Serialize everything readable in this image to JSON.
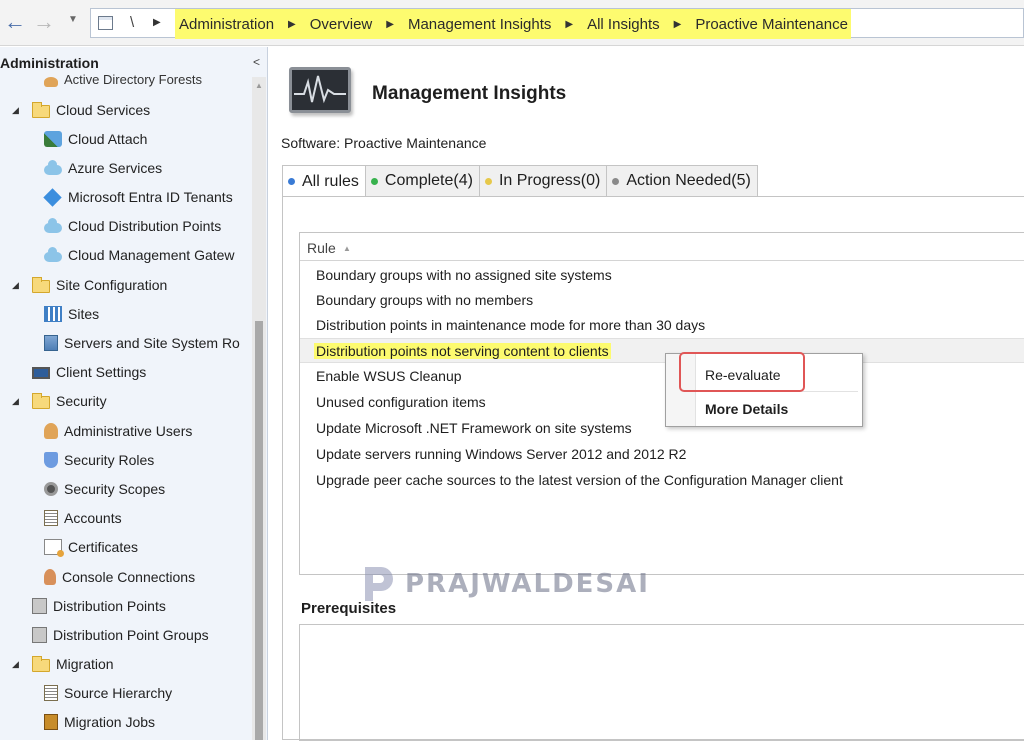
{
  "address_bar": {
    "root_label": "\\",
    "breadcrumbs": [
      "Administration",
      "Overview",
      "Management Insights",
      "All Insights",
      "Proactive Maintenance"
    ]
  },
  "nav_pane": {
    "title": "Administration",
    "collapse_glyph": "<",
    "cut_off_item": "Active Directory Forests",
    "items": [
      {
        "label": "Cloud Services",
        "icon": "folder-icon"
      },
      {
        "label": "Cloud Attach",
        "icon": "cloud-attach-icon"
      },
      {
        "label": "Azure Services",
        "icon": "cloud-icon"
      },
      {
        "label": "Microsoft Entra ID Tenants",
        "icon": "entra-icon"
      },
      {
        "label": "Cloud Distribution Points",
        "icon": "cloud-icon"
      },
      {
        "label": "Cloud Management Gatew",
        "icon": "cloud-icon"
      },
      {
        "label": "Site Configuration",
        "icon": "folder-icon"
      },
      {
        "label": "Sites",
        "icon": "sites-icon"
      },
      {
        "label": "Servers and Site System Ro",
        "icon": "server-icon"
      },
      {
        "label": "Client Settings",
        "icon": "client-settings-icon"
      },
      {
        "label": "Security",
        "icon": "folder-icon"
      },
      {
        "label": "Administrative Users",
        "icon": "admin-users-icon"
      },
      {
        "label": "Security Roles",
        "icon": "security-roles-icon"
      },
      {
        "label": "Security Scopes",
        "icon": "security-scopes-icon"
      },
      {
        "label": "Accounts",
        "icon": "accounts-icon"
      },
      {
        "label": "Certificates",
        "icon": "certificate-icon"
      },
      {
        "label": "Console Connections",
        "icon": "console-connections-icon"
      },
      {
        "label": "Distribution Points",
        "icon": "distribution-points-icon"
      },
      {
        "label": "Distribution Point Groups",
        "icon": "dp-groups-icon"
      },
      {
        "label": "Migration",
        "icon": "folder-icon"
      },
      {
        "label": "Source Hierarchy",
        "icon": "source-hierarchy-icon"
      },
      {
        "label": "Migration Jobs",
        "icon": "migration-jobs-icon"
      }
    ]
  },
  "main": {
    "title": "Management Insights",
    "software_label": "Software:",
    "software_value": "Proactive Maintenance",
    "tabs": [
      {
        "label": "All rules",
        "dot_color": "#3a7bd5"
      },
      {
        "label": "Complete(4)",
        "dot_color": "#37b24d"
      },
      {
        "label": "In Progress(0)",
        "dot_color": "#e6c84a"
      },
      {
        "label": "Action Needed(5)",
        "dot_color": "#8a8a8a"
      }
    ],
    "grid": {
      "column_header": "Rule",
      "rows": [
        "Boundary groups with no assigned site systems",
        "Boundary groups with no members",
        "Distribution points in maintenance mode for more than 30 days",
        "Distribution points not serving content to clients",
        "Enable WSUS Cleanup",
        "Unused configuration items",
        "Update Microsoft .NET Framework on site systems",
        "Update servers running Windows Server 2012 and 2012 R2",
        "Upgrade peer cache sources to the latest version of the Configuration Manager client"
      ],
      "selected_row": "Distribution points not serving content to clients"
    },
    "prerequisites_label": "Prerequisites"
  },
  "context_menu": {
    "items": [
      "Re-evaluate",
      "More Details"
    ]
  },
  "watermark": {
    "text": "PRAJWALDESAI"
  },
  "colors": {
    "highlight_yellow": "#fdfb6f",
    "annotation_red": "#e05656"
  }
}
